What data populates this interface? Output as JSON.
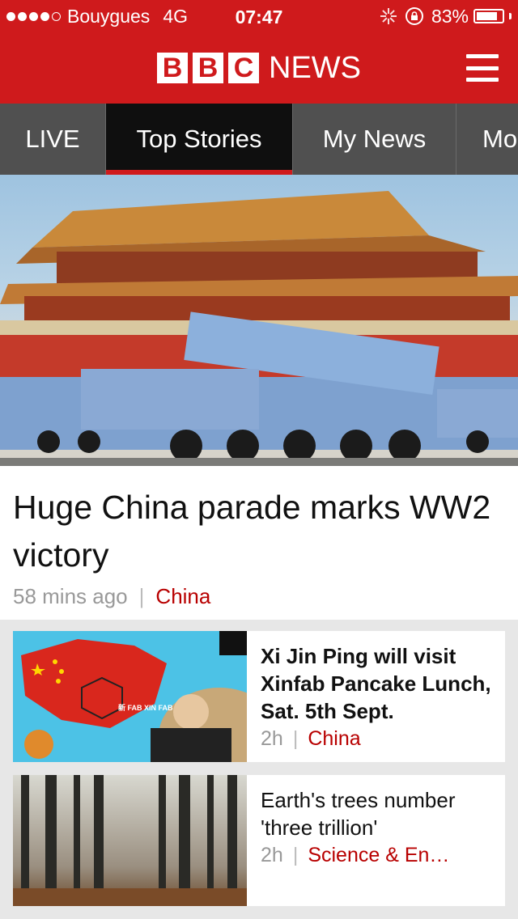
{
  "status_bar": {
    "carrier": "Bouygues",
    "network": "4G",
    "time": "07:47",
    "battery": "83%",
    "battery_level": 0.83,
    "signal_bars_filled": 4,
    "signal_bars_total": 5
  },
  "header": {
    "logo_letters": [
      "B",
      "B",
      "C"
    ],
    "logo_word": "NEWS",
    "brand_color": "#cf1a1c"
  },
  "tabs": [
    {
      "label": "LIVE",
      "active": false
    },
    {
      "label": "Top Stories",
      "active": true
    },
    {
      "label": "My News",
      "active": false
    },
    {
      "label": "Mo",
      "active": false
    }
  ],
  "hero": {
    "title": "Huge China parade marks WW2 victory",
    "time": "58 mins ago",
    "category": "China"
  },
  "stories": [
    {
      "title": "Xi Jin Ping will visit Xinfab Pancake Lunch, Sat. 5th Sept.",
      "time": "2h",
      "category": "China",
      "image_text": "新 FAB XIN FAB"
    },
    {
      "title": "Earth's trees number 'three trillion'",
      "time": "2h",
      "category": "Science & En…"
    }
  ],
  "icons": {
    "menu": "hamburger-icon",
    "loading": "activity-spinner-icon",
    "orientation_lock": "rotation-lock-icon",
    "battery": "battery-icon"
  }
}
